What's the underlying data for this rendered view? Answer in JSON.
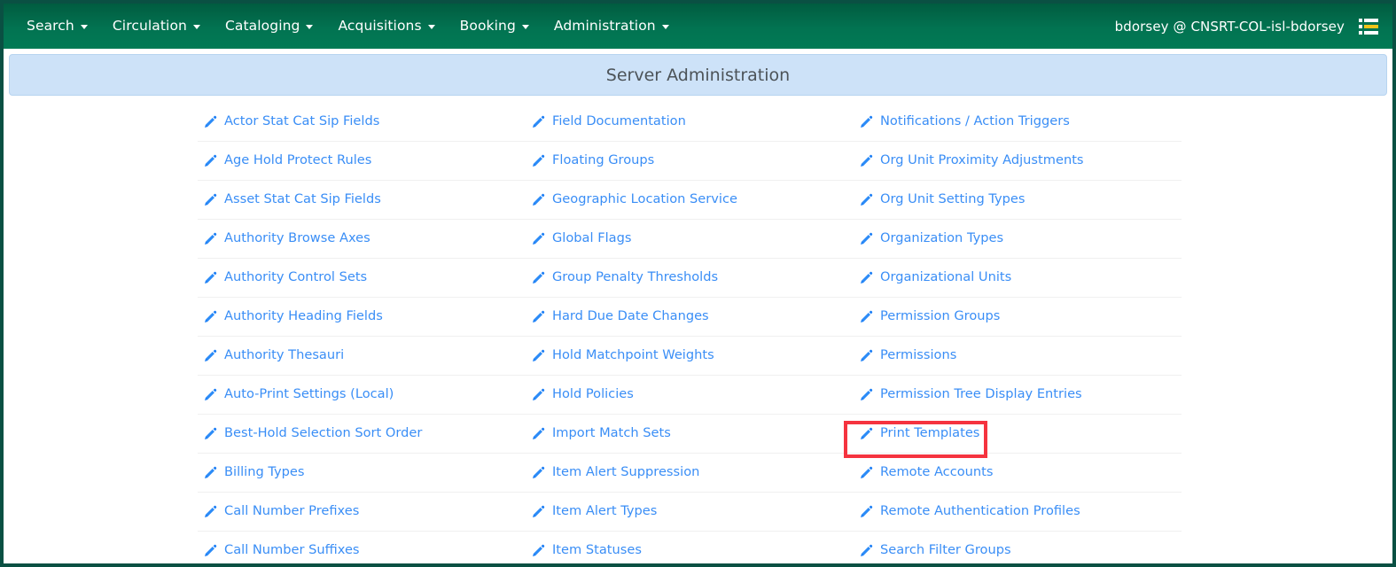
{
  "navbar": {
    "menus": [
      {
        "label": "Search",
        "icon": "chevron-down-icon"
      },
      {
        "label": "Circulation",
        "icon": "chevron-down-icon"
      },
      {
        "label": "Cataloging",
        "icon": "chevron-down-icon"
      },
      {
        "label": "Acquisitions",
        "icon": "chevron-down-icon"
      },
      {
        "label": "Booking",
        "icon": "chevron-down-icon"
      },
      {
        "label": "Administration",
        "icon": "chevron-down-icon"
      }
    ],
    "user": "bdorsey @ CNSRT-COL-isl-bdorsey",
    "menu_icon": "list-menu-icon",
    "background_color": "#027351",
    "text_color": "#ffffff"
  },
  "banner": {
    "title": "Server Administration",
    "background_color": "#cde2f8",
    "text_color": "#4c5358"
  },
  "admin": {
    "link_color": "#3a8ef6",
    "row_icon": "pencil-icon",
    "columns": [
      [
        "Actor Stat Cat Sip Fields",
        "Age Hold Protect Rules",
        "Asset Stat Cat Sip Fields",
        "Authority Browse Axes",
        "Authority Control Sets",
        "Authority Heading Fields",
        "Authority Thesauri",
        "Auto-Print Settings (Local)",
        "Best-Hold Selection Sort Order",
        "Billing Types",
        "Call Number Prefixes",
        "Call Number Suffixes"
      ],
      [
        "Field Documentation",
        "Floating Groups",
        "Geographic Location Service",
        "Global Flags",
        "Group Penalty Thresholds",
        "Hard Due Date Changes",
        "Hold Matchpoint Weights",
        "Hold Policies",
        "Import Match Sets",
        "Item Alert Suppression",
        "Item Alert Types",
        "Item Statuses"
      ],
      [
        "Notifications / Action Triggers",
        "Org Unit Proximity Adjustments",
        "Org Unit Setting Types",
        "Organization Types",
        "Organizational Units",
        "Permission Groups",
        "Permissions",
        "Permission Tree Display Entries",
        "Print Templates",
        "Remote Accounts",
        "Remote Authentication Profiles",
        "Search Filter Groups"
      ]
    ]
  },
  "highlight": {
    "target_label": "Print Templates",
    "color": "#f5333f"
  }
}
